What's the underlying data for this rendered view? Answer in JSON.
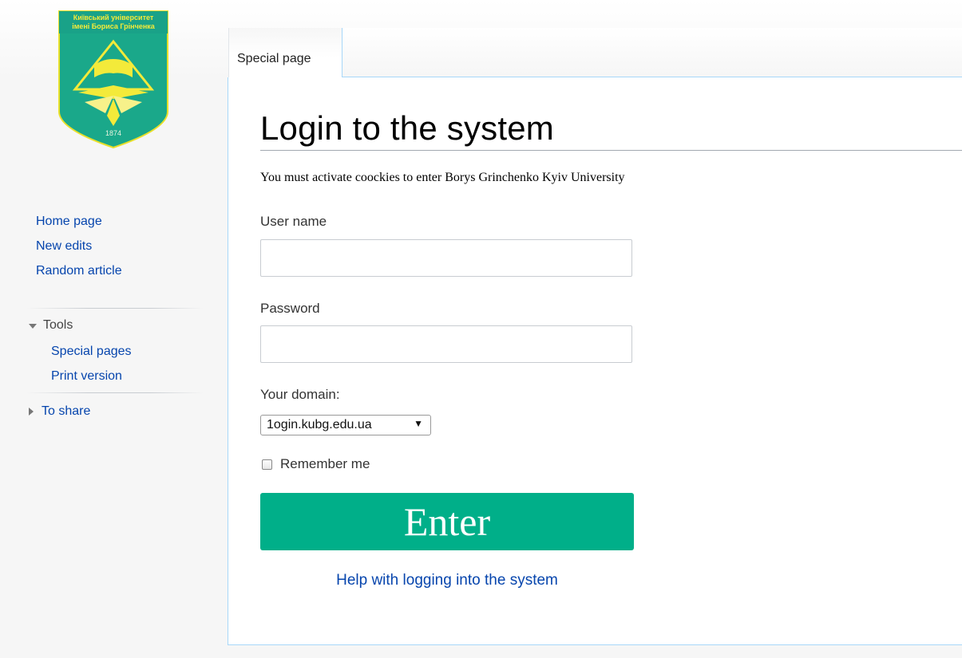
{
  "logo": {
    "line1": "Київський університет",
    "line2": "імені Бориса Грінченка",
    "year": "1874"
  },
  "sidebar": {
    "navigation": [
      {
        "label": "Home page"
      },
      {
        "label": "New edits"
      },
      {
        "label": "Random article"
      }
    ],
    "tools": {
      "heading": "Tools",
      "items": [
        {
          "label": "Special pages"
        },
        {
          "label": "Print version"
        }
      ]
    },
    "share": {
      "heading": "To share"
    }
  },
  "tabs": [
    {
      "label": "Special page"
    }
  ],
  "page": {
    "title": "Login to the system",
    "notice": "You must activate coockies to enter Borys Grinchenko Kyiv University"
  },
  "form": {
    "username_label": "User name",
    "username_value": "",
    "password_label": "Password",
    "password_value": "",
    "domain_label": "Your domain:",
    "domain_selected": "1ogin.kubg.edu.ua",
    "remember_label": "Remember me",
    "remember_checked": false,
    "submit_label": "Enter",
    "help_link": "Help with logging into the system"
  },
  "colors": {
    "accent_button": "#00af89",
    "link": "#0645ad",
    "logo_green": "#1aa88a",
    "logo_gold": "#e9e02a"
  }
}
